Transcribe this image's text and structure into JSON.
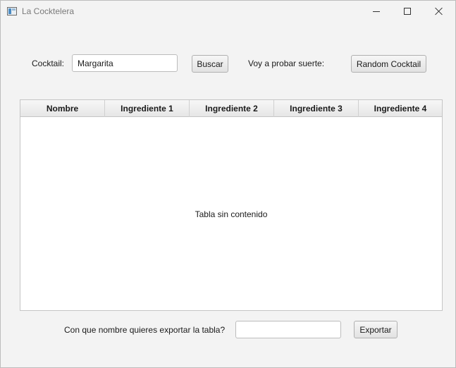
{
  "window": {
    "title": "La Cocktelera",
    "icons": {
      "app": "app-window-icon",
      "minimize": "minimize-icon",
      "maximize": "maximize-icon",
      "close": "close-icon"
    }
  },
  "search": {
    "label": "Cocktail:",
    "value": "Margarita",
    "button_label": "Buscar"
  },
  "random": {
    "label": "Voy a probar suerte:",
    "button_label": "Random Cocktail"
  },
  "table": {
    "columns": [
      "Nombre",
      "Ingrediente 1",
      "Ingrediente 2",
      "Ingrediente 3",
      "Ingrediente 4"
    ],
    "rows": [],
    "empty_message": "Tabla sin contenido"
  },
  "export": {
    "label": "Con que nombre quieres exportar la tabla?",
    "value": "",
    "button_label": "Exportar"
  }
}
